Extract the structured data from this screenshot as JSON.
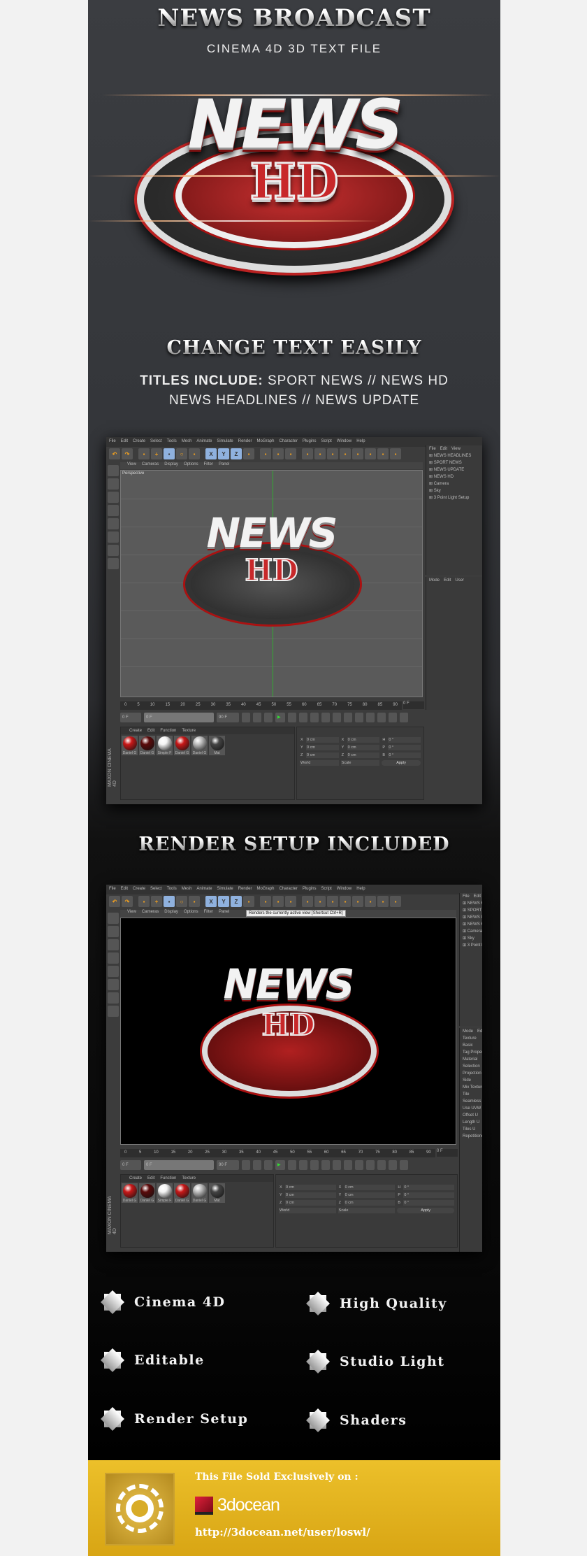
{
  "header": {
    "title": "NEWS BROADCAST",
    "subtitle": "CINEMA 4D 3D TEXT FILE"
  },
  "hero": {
    "word1": "NEWS",
    "word2": "HD"
  },
  "section1": {
    "heading": "CHANGE TEXT EASILY",
    "titles_label": "TITLES INCLUDE:",
    "titles_line1": "SPORT NEWS // NEWS HD",
    "titles_line2": "NEWS HEADLINES // NEWS UPDATE"
  },
  "section2": {
    "heading": "RENDER SETUP INCLUDED"
  },
  "c4d": {
    "menus": [
      "File",
      "Edit",
      "Create",
      "Select",
      "Tools",
      "Mesh",
      "Animate",
      "Simulate",
      "Render",
      "MoGraph",
      "Character",
      "Plugins",
      "Script",
      "Window",
      "Help"
    ],
    "toolbar_icons": [
      "undo",
      "redo",
      "move-select",
      "move",
      "scale",
      "rotate",
      "scale-box",
      "x-axis",
      "y-axis",
      "z-axis",
      "coordinate-system",
      "render-view",
      "render-picture-viewer",
      "render-settings",
      "cube",
      "spline",
      "nurbs",
      "mograph-cloner",
      "deformer",
      "floor",
      "camera",
      "light"
    ],
    "viewport_menu": [
      "View",
      "Cameras",
      "Display",
      "Options",
      "Filter",
      "Panel"
    ],
    "viewport_label": "Perspective",
    "objmgr_menu": [
      "File",
      "Edit",
      "View"
    ],
    "objects": [
      "NEWS HEADLINES",
      "SPORT NEWS",
      "NEWS UPDATE",
      "NEWS HD",
      "Camera",
      "Sky",
      "3 Point Light Setup"
    ],
    "attr_menu": [
      "Mode",
      "Edit",
      "User"
    ],
    "timeline_ticks": [
      "0",
      "5",
      "10",
      "15",
      "20",
      "25",
      "30",
      "35",
      "40",
      "45",
      "50",
      "55",
      "60",
      "65",
      "70",
      "75",
      "80",
      "85",
      "90"
    ],
    "current_frame": "0 F",
    "start_frame": "0 F",
    "range_start": "0 F",
    "range_end": "90 F",
    "end_frame": "90 F",
    "mat_menu": [
      "Create",
      "Edit",
      "Function",
      "Texture"
    ],
    "materials": [
      {
        "name": "Daniel G",
        "color": "#c81818"
      },
      {
        "name": "Daniel G",
        "color": "#5a0a0a"
      },
      {
        "name": "Simple F",
        "color": "#f4f4f4"
      },
      {
        "name": "Daniel G",
        "color": "#c81818"
      },
      {
        "name": "Daniel G",
        "color": "#bdbdbd"
      },
      {
        "name": "Mat",
        "color": "#444444"
      }
    ],
    "coords": [
      [
        "X",
        "0 cm",
        "X",
        "0 cm",
        "H",
        "0 °"
      ],
      [
        "Y",
        "0 cm",
        "Y",
        "0 cm",
        "P",
        "0 °"
      ],
      [
        "Z",
        "0 cm",
        "Z",
        "0 cm",
        "B",
        "0 °"
      ]
    ],
    "coord_mode": "World",
    "coord_size": "Scale",
    "apply": "Apply",
    "brand": "MAXON CINEMA 4D",
    "tooltip": "Renders the currently active view [Shortcut Ctrl+R]",
    "attr_items": [
      "Texture",
      "Basic",
      "Tag Properties",
      "Material",
      "Selection",
      "Projection",
      "Side",
      "Mix Textures",
      "Tile",
      "Seamless",
      "Use UVW",
      "Offset U",
      "Length U",
      "Tiles U",
      "Repetitions"
    ]
  },
  "features": [
    "Cinema 4D",
    "High Quality",
    "Editable",
    "Studio Light",
    "Render Setup",
    "Shaders"
  ],
  "footer": {
    "sold_text": "This File Sold Exclusively on :",
    "brand": "3docean",
    "url": "http://3docean.net/user/loswl/"
  },
  "colors": {
    "accent_red": "#c8282a",
    "footer_yellow": "#e3b41f",
    "background": "#35373b"
  }
}
